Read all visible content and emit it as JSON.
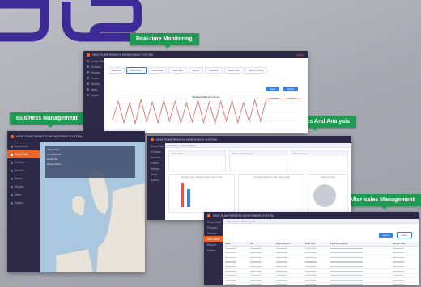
{
  "callouts": {
    "realtime": "Real-time Monitoring",
    "business": "Business Management",
    "data": "Data Statistics And Analysis",
    "aftersales": "After-sales Management"
  },
  "colors": {
    "accent": "#e8652c",
    "callout": "#1f9a52",
    "sidebar": "#2d2946",
    "primary": "#3d7ddc",
    "chart_line": "#e0776f"
  },
  "business_window": {
    "title": "HEAT PUMP REMOTE MONITORING SYSTEM",
    "user": "Admin",
    "sidebar": [
      "Dashboard",
      "Group Plant",
      "Products",
      "Devices",
      "Events",
      "Reports",
      "Alarm",
      "System"
    ],
    "active_index": 1,
    "menu_rows": [
      "Group Plant",
      "All Customers",
      "Device list",
      "Device Status"
    ]
  },
  "realtime_window": {
    "title": "HEAT PUMP REMOTE MONITORING SYSTEM",
    "user": "Admin",
    "tabs": [
      "Realtime",
      "Parameters",
      "Curve data",
      "Fault data",
      "History",
      "Statistics",
      "Device Info",
      "Device Config"
    ],
    "active_tab": 1,
    "chart_title": "Realtime Statistics Curve",
    "query_button": "Query",
    "export_button": "Export",
    "sidebar": [
      "Group Plant",
      "Products",
      "Devices",
      "Events",
      "Reports",
      "Alarm",
      "System"
    ]
  },
  "data_window": {
    "title": "HEAT PUMP REMOTE MONITORING SYSTEM",
    "breadcrumb": "Statistics > Data Analysis",
    "headers": [
      "Device Status",
      "Device Manufacturer",
      "Device Location"
    ],
    "pie_title": "Device Model",
    "bar_title": "Device online statistics in the past month",
    "middle_title": "Hot water statistics in the past month",
    "sidebar": [
      "Group Plant",
      "Products",
      "Devices",
      "Events",
      "Reports",
      "Alarm",
      "System"
    ]
  },
  "aftersales_window": {
    "title": "HEAT PUMP REMOTE MONITORING SYSTEM",
    "breadcrumb": "After-sales > Fault records",
    "columns": [
      "Index",
      "SN",
      "Device model",
      "Fault time",
      "Fault description",
      "Handle state"
    ],
    "query_button": "Query",
    "reset_button": "Reset",
    "sidebar": [
      "Group Plant",
      "Products",
      "Devices",
      "After-sales",
      "Reports",
      "System"
    ]
  },
  "chart_data": {
    "type": "line",
    "series": [
      {
        "values": [
          38,
          62,
          34,
          60,
          33,
          64,
          35,
          61,
          34,
          63,
          36,
          62,
          33,
          60,
          35,
          64,
          34,
          61,
          33,
          62,
          36,
          63,
          34,
          60,
          35,
          64,
          36,
          65,
          66,
          66,
          65,
          66,
          66,
          65
        ]
      }
    ]
  }
}
